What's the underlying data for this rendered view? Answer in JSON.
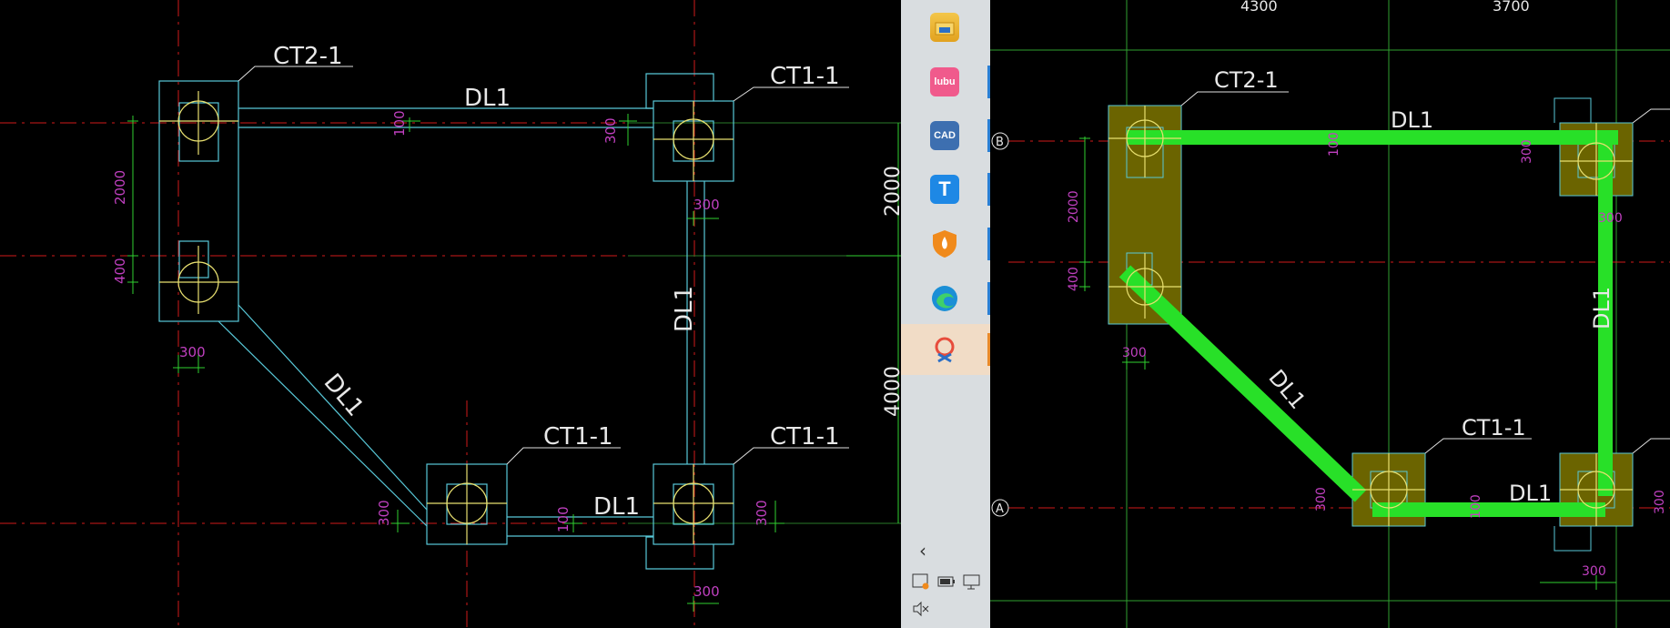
{
  "left_drawing": {
    "labels": {
      "ct2_1": "CT2-1",
      "ct1_1_tr": "CT1-1",
      "ct1_1_bl": "CT1-1",
      "ct1_1_br": "CT1-1",
      "dl1_top": "DL1",
      "dl1_right": "DL1",
      "dl1_diag": "DL1",
      "dl1_bottom": "DL1"
    },
    "dims": {
      "d2000_left": "2000",
      "d400_left": "400",
      "d300_left": "300",
      "d100_top": "100",
      "d300_top": "300",
      "d300_right_mid": "300",
      "d300_bl": "300",
      "d100_bottom": "100",
      "d300_br": "300",
      "d300_bottom": "300",
      "d2000_right": "2000",
      "d4000_right": "4000"
    }
  },
  "right_drawing": {
    "labels": {
      "ct2_1": "CT2-1",
      "ct1_1": "CT1-1",
      "dl1_top": "DL1",
      "dl1_right": "DL1",
      "dl1_diag": "DL1",
      "dl1_bottom": "DL1"
    },
    "dims": {
      "top_4300": "4300",
      "top_3700": "3700",
      "d2000": "2000",
      "d400": "400",
      "d300_left": "300",
      "d100_top": "100",
      "d300_top": "300",
      "d300_right": "300",
      "d300_bl": "300",
      "d100_bottom": "100",
      "d300_bottom": "300",
      "d300_br": "300"
    },
    "axes": {
      "b": "B",
      "a": "A"
    }
  },
  "colors": {
    "background": "#000000",
    "axis_red": "#d01a1a",
    "outline_cyan": "#58c8d8",
    "circle_yellow": "#e8e070",
    "dim_green": "#30d030",
    "dim_text_magenta": "#c040c0",
    "fill_olive": "#6b6400",
    "beam_green": "#28e028"
  },
  "taskbar": {
    "apps": [
      {
        "icon": "file-explorer-icon"
      },
      {
        "icon": "ladybug-app-icon",
        "text": "lubu"
      },
      {
        "icon": "cad-app-icon",
        "text": "CAD"
      },
      {
        "icon": "text-editor-icon",
        "text": "T"
      },
      {
        "icon": "security-shield-icon"
      },
      {
        "icon": "edge-browser-icon"
      },
      {
        "icon": "screenshot-tool-icon"
      }
    ],
    "tray": {
      "chevron": "‹",
      "mute_icon": "mute-speaker-icon"
    }
  }
}
